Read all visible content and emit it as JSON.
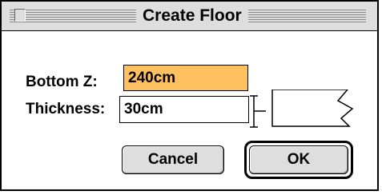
{
  "dialog": {
    "title": "Create Floor"
  },
  "fields": {
    "bottom_z_label": "Bottom Z:",
    "bottom_z_value": "240cm",
    "thickness_label": "Thickness:",
    "thickness_value": "30cm"
  },
  "buttons": {
    "cancel_label": "Cancel",
    "ok_label": "OK"
  },
  "colors": {
    "highlight_field": "#ffc160",
    "titlebar_bg": "#dedede",
    "button_bg": "#dedede"
  },
  "icons": {
    "close_box": "close-box-icon",
    "thickness_diagram": "floor-thickness-diagram-icon"
  }
}
